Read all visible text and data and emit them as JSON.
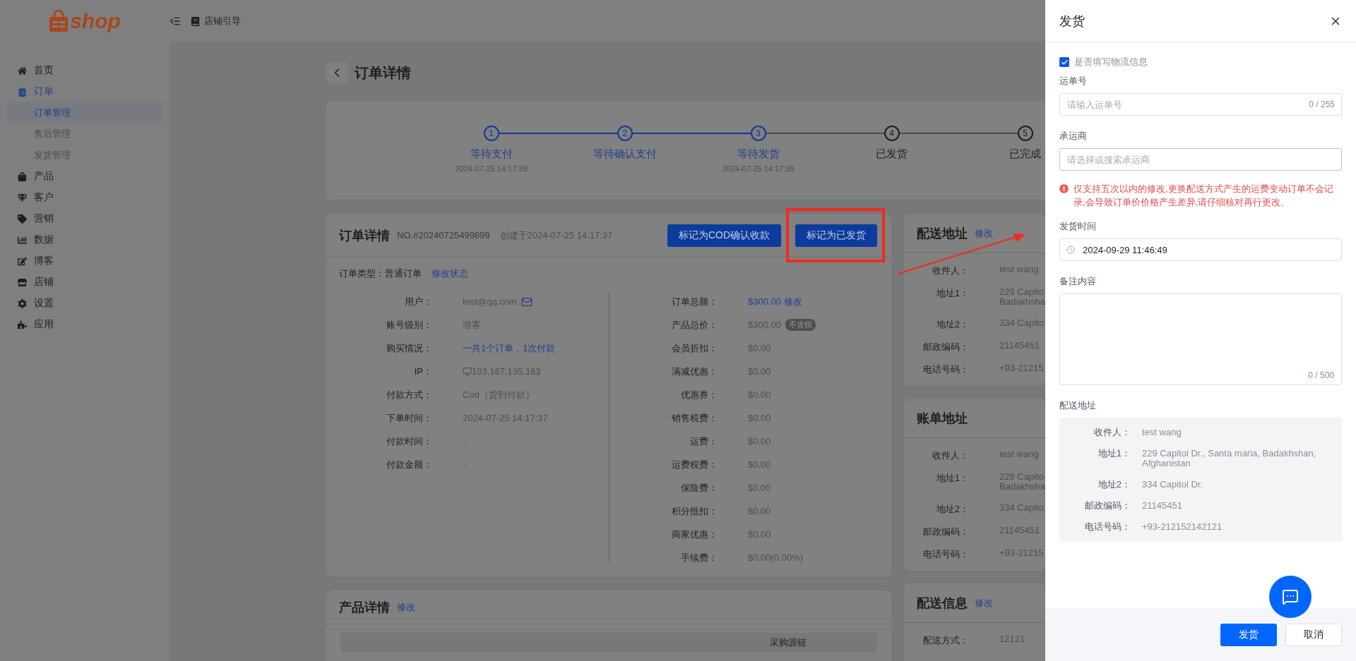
{
  "header": {
    "logo": "shop",
    "guide": "店铺引导"
  },
  "sidebar": {
    "items": [
      {
        "label": "首页",
        "selected": false
      },
      {
        "label": "订单",
        "selected": true,
        "children": [
          {
            "label": "订单管理",
            "selected": true
          },
          {
            "label": "售后管理",
            "selected": false
          },
          {
            "label": "发货管理",
            "selected": false
          }
        ]
      },
      {
        "label": "产品",
        "selected": false
      },
      {
        "label": "客户",
        "selected": false
      },
      {
        "label": "营销",
        "selected": false
      },
      {
        "label": "数据",
        "selected": false
      },
      {
        "label": "博客",
        "selected": false
      },
      {
        "label": "店铺",
        "selected": false
      },
      {
        "label": "设置",
        "selected": false
      },
      {
        "label": "应用",
        "selected": false
      }
    ]
  },
  "page": {
    "title": "订单详情"
  },
  "steps": [
    {
      "number": "1",
      "label": "等待支付",
      "time": "2024-07-25 14:17:39",
      "reached": true
    },
    {
      "number": "2",
      "label": "等待确认支付",
      "reached": true
    },
    {
      "number": "3",
      "label": "等待发货",
      "time": "2024-07-25 14:17:39",
      "reached": true
    },
    {
      "number": "4",
      "label": "已发货",
      "reached": false
    },
    {
      "number": "5",
      "label": "已完成",
      "reached": false
    }
  ],
  "order": {
    "title": "订单详情",
    "number": "NO.#20240725499899",
    "created": "创建于2024-07-25 14:17:37",
    "buttons": [
      {
        "label": "标记为COD确认收款",
        "marked": false
      },
      {
        "label": "标记为已发货",
        "marked": true
      }
    ],
    "type": "订单类型：普通订单",
    "type_link": "修改状态",
    "left_rows": [
      {
        "label": "用户：",
        "value": "test@qq.com",
        "kind": "email"
      },
      {
        "label": "账号级别：",
        "value": "游客",
        "kind": "plain"
      },
      {
        "label": "购买情况：",
        "value": "一共1个订单，1次付款",
        "kind": "link"
      },
      {
        "label": "IP：",
        "value": "103.167.135.163",
        "kind": "ip"
      },
      {
        "label": "付款方式：",
        "value": "Cod（货到付款）",
        "kind": "plain"
      },
      {
        "label": "下单时间：",
        "value": "2024-07-25 14:17:37",
        "kind": "plain"
      },
      {
        "label": "付款时间：",
        "value": "-",
        "kind": "plain"
      },
      {
        "label": "付款金额：",
        "value": "-",
        "kind": "plain"
      }
    ],
    "right_rows": [
      {
        "label": "订单总额：",
        "value": "$300.00",
        "link": "修改",
        "kind": "link"
      },
      {
        "label": "产品总价：",
        "value": "$300.00",
        "badge": "不含税",
        "kind": "badge"
      },
      {
        "label": "会员折扣：",
        "value": "$0.00",
        "kind": "plain"
      },
      {
        "label": "满减优惠：",
        "value": "$0.00",
        "kind": "plain"
      },
      {
        "label": "优惠券：",
        "value": "$0.00",
        "kind": "plain"
      },
      {
        "label": "销售税费：",
        "value": "$0.00",
        "kind": "plain"
      },
      {
        "label": "运费：",
        "value": "$0.00",
        "kind": "plain"
      },
      {
        "label": "运费税费：",
        "value": "$0.00",
        "kind": "plain"
      },
      {
        "label": "保险费：",
        "value": "$0.00",
        "kind": "plain"
      },
      {
        "label": "积分抵扣：",
        "value": "$0.00",
        "kind": "plain"
      },
      {
        "label": "商家优惠：",
        "value": "$0.00",
        "kind": "plain"
      },
      {
        "label": "手续费：",
        "value": "$0.00(0.00%)",
        "kind": "plain"
      }
    ]
  },
  "side_cards": [
    {
      "title": "配送地址",
      "link": "修改",
      "rows": [
        {
          "label": "收件人：",
          "lines": [
            "test wang"
          ]
        },
        {
          "label": "地址1：",
          "lines": [
            "229 Capito",
            "Badakhsha"
          ]
        },
        {
          "label": "地址2：",
          "lines": [
            "334 Capito"
          ]
        },
        {
          "label": "邮政编码：",
          "lines": [
            "21145451"
          ]
        },
        {
          "label": "电话号码：",
          "lines": [
            "+93-21215"
          ]
        }
      ]
    },
    {
      "title": "账单地址",
      "rows": [
        {
          "label": "收件人：",
          "lines": [
            "test wang"
          ]
        },
        {
          "label": "地址1：",
          "lines": [
            "229 Capito",
            "Badakhsha"
          ]
        },
        {
          "label": "地址2：",
          "lines": [
            "334 Capito"
          ]
        },
        {
          "label": "邮政编码：",
          "lines": [
            "21145451"
          ]
        },
        {
          "label": "电话号码：",
          "lines": [
            "+93-21215"
          ]
        }
      ]
    },
    {
      "title": "配送信息",
      "link": "修改",
      "rows": [
        {
          "label": "配送方式：",
          "lines": [
            "12121"
          ]
        }
      ]
    }
  ],
  "products": {
    "title": "产品详情",
    "link": "修改",
    "columns": [
      {
        "label": "采购源链"
      }
    ]
  },
  "drawer": {
    "title": "发货",
    "logistics": {
      "label": "是否填写物流信息",
      "checked": true
    },
    "tracking": {
      "label": "运单号",
      "placeholder": "请输入运单号",
      "counter": "0 / 255"
    },
    "carrier": {
      "label": "承运商",
      "placeholder": "请选择或搜索承运商"
    },
    "warning": "仅支持五次以内的修改,更换配送方式产生的运费变动订单不会记录,会导致订单价价格产生差异,请仔细核对再行更改。",
    "ship_time": {
      "label": "发货时间",
      "value": "2024-09-29 11:46:49"
    },
    "note": {
      "label": "备注内容",
      "counter": "0 / 500"
    },
    "address": {
      "label": "配送地址",
      "rows": [
        {
          "label": "收件人：",
          "value": "test wang"
        },
        {
          "label": "地址1：",
          "value": "229 Capitol Dr., Santa maria, Badakhshan, Afghanistan"
        },
        {
          "label": "地址2：",
          "value": "334 Capitol Dr."
        },
        {
          "label": "邮政编码：",
          "value": "21145451"
        },
        {
          "label": "电话号码：",
          "value": "+93-212152142121"
        }
      ]
    },
    "buttons": {
      "confirm": "发货",
      "cancel": "取消"
    }
  }
}
